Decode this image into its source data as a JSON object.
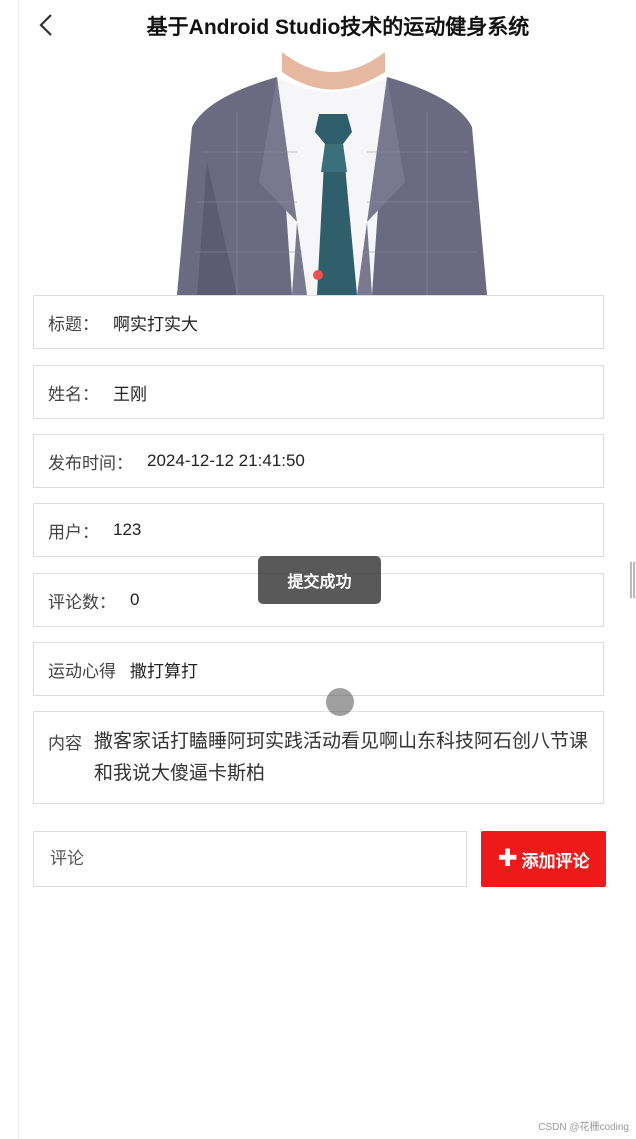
{
  "header": {
    "title": "基于Android Studio技术的运动健身系统"
  },
  "fields": {
    "title": {
      "label": "标题：",
      "value": "啊实打实大"
    },
    "name": {
      "label": "姓名：",
      "value": "王刚"
    },
    "publish_time": {
      "label": "发布时间：",
      "value": "2024-12-12 21:41:50"
    },
    "user": {
      "label": "用户：",
      "value": "123"
    },
    "comment_count": {
      "label": "评论数：",
      "value": "0"
    },
    "experience": {
      "label": "运动心得",
      "value": "撒打算打"
    },
    "content": {
      "label": "内容",
      "value": "撒客家话打瞌睡阿珂实践活动看见啊山东科技阿石创八节课和我说大傻逼卡斯柏"
    }
  },
  "comment": {
    "placeholder": "评论",
    "add_label": "添加评论"
  },
  "toast": {
    "text": "提交成功"
  },
  "watermark": "CSDN @花栅coding"
}
